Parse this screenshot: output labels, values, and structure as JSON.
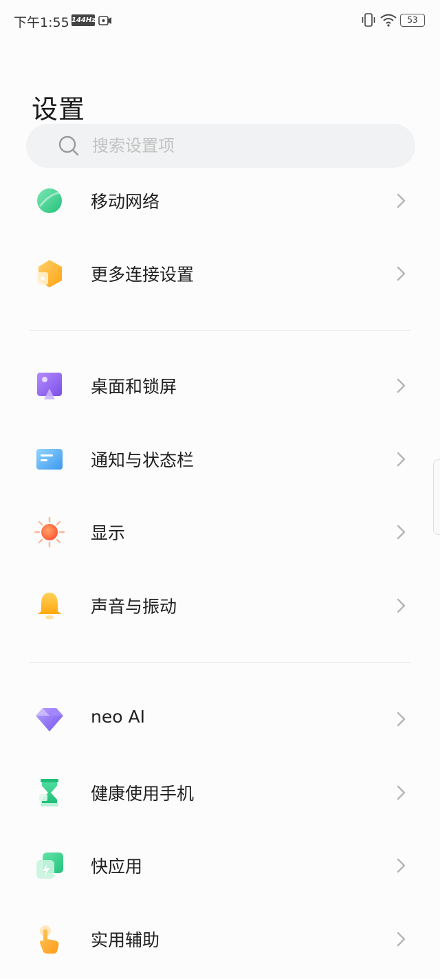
{
  "status_bar": {
    "time": "下午1:55",
    "refresh_rate": "144Hz",
    "battery": "53"
  },
  "page": {
    "title": "设置"
  },
  "search": {
    "placeholder": "搜索设置项"
  },
  "items": [
    {
      "label": "移动网络",
      "icon": "mobile-network-icon"
    },
    {
      "label": "更多连接设置",
      "icon": "more-connections-icon"
    },
    {
      "label": "桌面和锁屏",
      "icon": "wallpaper-icon"
    },
    {
      "label": "通知与状态栏",
      "icon": "notification-icon"
    },
    {
      "label": "显示",
      "icon": "display-sun-icon"
    },
    {
      "label": "声音与振动",
      "icon": "sound-bell-icon"
    },
    {
      "label": "neo AI",
      "icon": "diamond-icon"
    },
    {
      "label": "健康使用手机",
      "icon": "hourglass-icon"
    },
    {
      "label": "快应用",
      "icon": "quick-app-icon"
    },
    {
      "label": "实用辅助",
      "icon": "accessibility-hand-icon"
    }
  ],
  "colors": {
    "network": "#3ccf8e",
    "connections": "#ffb52e",
    "wallpaper": "#9b6cf0",
    "notification": "#4aa8f0",
    "display": "#ff6a3c",
    "sound": "#ffb81c",
    "neo_ai": "#8c6cf5",
    "health": "#2ecf8a",
    "quick_app": "#3fd08a",
    "accessibility": "#ffa928"
  }
}
